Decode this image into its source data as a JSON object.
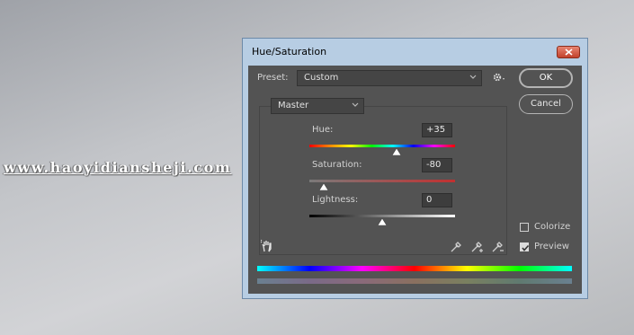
{
  "watermark": "www.haoyidiansheji.com",
  "window": {
    "title": "Hue/Saturation"
  },
  "preset": {
    "label": "Preset:",
    "value": "Custom"
  },
  "buttons": {
    "ok": "OK",
    "cancel": "Cancel"
  },
  "channel": {
    "value": "Master"
  },
  "sliders": {
    "hue": {
      "label": "Hue:",
      "value": "+35",
      "level": 0.597
    },
    "saturation": {
      "label": "Saturation:",
      "value": "-80",
      "level": 0.1
    },
    "lightness": {
      "label": "Lightness:",
      "value": "0",
      "level": 0.5
    }
  },
  "options": {
    "colorize": {
      "label": "Colorize",
      "checked": false
    },
    "preview": {
      "label": "Preview",
      "checked": true
    }
  },
  "icons": {
    "close": "close-icon",
    "gear": "gear-icon",
    "hand": "hand-icon",
    "eyedropper": "eyedropper-icon",
    "eyedropper_plus": "eyedropper-plus-icon",
    "eyedropper_minus": "eyedropper-minus-icon"
  }
}
